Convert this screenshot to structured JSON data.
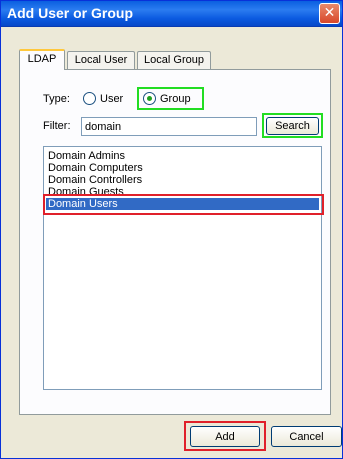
{
  "window": {
    "title": "Add User or Group",
    "title_color": "#ffffff",
    "close_glyph": "✕"
  },
  "tabs": [
    {
      "label": "LDAP",
      "active": true
    },
    {
      "label": "Local User",
      "active": false
    },
    {
      "label": "Local Group",
      "active": false
    }
  ],
  "type_row": {
    "label": "Type:",
    "options": [
      {
        "label": "User",
        "selected": false
      },
      {
        "label": "Group",
        "selected": true
      }
    ]
  },
  "filter": {
    "label": "Filter:",
    "value": "domain",
    "search_label": "Search"
  },
  "results": {
    "items": [
      {
        "label": "Domain Admins",
        "selected": false
      },
      {
        "label": "Domain Computers",
        "selected": false
      },
      {
        "label": "Domain Controllers",
        "selected": false
      },
      {
        "label": "Domain Guests",
        "selected": false
      },
      {
        "label": "Domain Users",
        "selected": true
      }
    ]
  },
  "footer": {
    "add_label": "Add",
    "cancel_label": "Cancel"
  },
  "colors": {
    "dialog_bg": "#ece9d8",
    "titlebar": "#0a5fe0",
    "selection": "#316ac5",
    "highlight_green": "#22dd22",
    "highlight_red": "#e0202a"
  }
}
